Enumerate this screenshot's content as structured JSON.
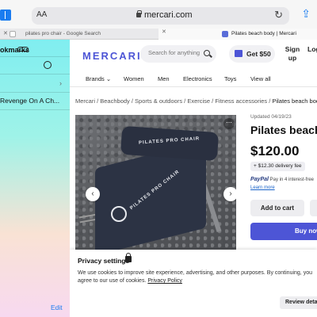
{
  "browser": {
    "aa_label": "AA",
    "domain": "mercari.com",
    "reload_symbol": "↻",
    "share_symbol": "⇪",
    "tabs": [
      {
        "close": "✕",
        "title": "pilates pro chair - Google Search"
      },
      {
        "close": "✕",
        "title": "Pilates beach body | Mercari"
      }
    ]
  },
  "sidebar": {
    "title": "okmarks",
    "chevron": "›",
    "item": "Revenge On A Ch...",
    "edit_label": "Edit"
  },
  "header": {
    "logo": "MERCARI",
    "search_placeholder": "Search for anything",
    "promo_label": "Get $50",
    "signup_label": "Sign up",
    "login_label": "Log"
  },
  "nav": {
    "brands": "Brands ⌄",
    "women": "Women",
    "men": "Men",
    "electronics": "Electronics",
    "toys": "Toys",
    "view_all": "View all"
  },
  "breadcrumb": {
    "path": "Mercari / Beachbody / Sports & outdoors / Exercise / Fitness accessories / ",
    "current": "Pilates beach body"
  },
  "photo": {
    "menu": "⋯",
    "prev": "‹",
    "next": "›",
    "brand_text_1": "PILATES PRO CHAIR",
    "brand_text_2": "PILATES PRO CHAIR"
  },
  "product": {
    "updated": "Updated 04/19/23",
    "title": "Pilates beach",
    "price": "$120.00",
    "fee": "+ $12.30 delivery fee",
    "paypal_brand": "PayPal",
    "paypal_text": " Pay in 4 interest-free",
    "learn_more": "Learn more",
    "add_to_cart": "Add to cart",
    "buy_now": "Buy now"
  },
  "privacy": {
    "title": "Privacy settings",
    "text": "We use cookies to improve site experience, advertising, and other purposes. By continuing, you agree to our use of cookies.",
    "link": "Privacy Policy",
    "review_button": "Review details"
  },
  "colors": {
    "brand": "#4d55d6",
    "ios_blue": "#1a7cf0"
  }
}
